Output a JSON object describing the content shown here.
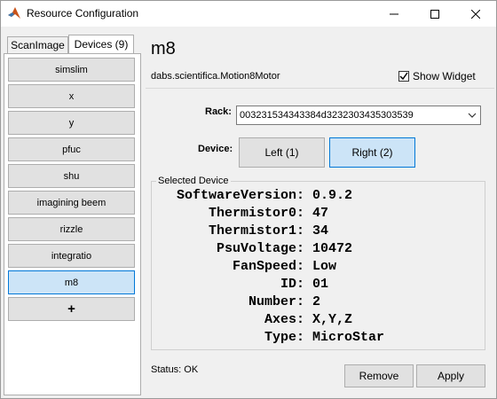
{
  "window": {
    "title": "Resource Configuration",
    "icon": "matlab-icon"
  },
  "tabs": [
    {
      "label": "ScanImage",
      "active": false
    },
    {
      "label": "Devices (9)",
      "active": true
    }
  ],
  "devices": [
    {
      "label": "simslim"
    },
    {
      "label": "x"
    },
    {
      "label": "y"
    },
    {
      "label": "pfuc"
    },
    {
      "label": "shu"
    },
    {
      "label": "imagining beem"
    },
    {
      "label": "rizzle"
    },
    {
      "label": "integratio"
    },
    {
      "label": "m8",
      "selected": true
    }
  ],
  "add_button_label": "+",
  "detail": {
    "name": "m8",
    "class_name": "dabs.scientifica.Motion8Motor",
    "show_widget_label": "Show Widget",
    "show_widget_checked": true,
    "rack_label": "Rack:",
    "rack_value": "003231534343384d3232303435303539",
    "device_label": "Device:",
    "left_button": "Left (1)",
    "right_button": "Right (2)",
    "selected_group_title": "Selected Device",
    "info": [
      {
        "key": "SoftwareVersion:",
        "value": "0.9.2"
      },
      {
        "key": "Thermistor0:",
        "value": "47"
      },
      {
        "key": "Thermistor1:",
        "value": "34"
      },
      {
        "key": "PsuVoltage:",
        "value": "10472"
      },
      {
        "key": "FanSpeed:",
        "value": "Low"
      },
      {
        "key": "ID:",
        "value": "01"
      },
      {
        "key": "Number:",
        "value": "2"
      },
      {
        "key": "Axes:",
        "value": "X,Y,Z"
      },
      {
        "key": "Type:",
        "value": "MicroStar"
      }
    ],
    "status": "Status: OK",
    "remove_button": "Remove",
    "apply_button": "Apply"
  },
  "colors": {
    "selected_bg": "#cce4f7",
    "selected_border": "#0078d7",
    "button_bg": "#e1e1e1",
    "window_bg": "#f0f0f0"
  }
}
